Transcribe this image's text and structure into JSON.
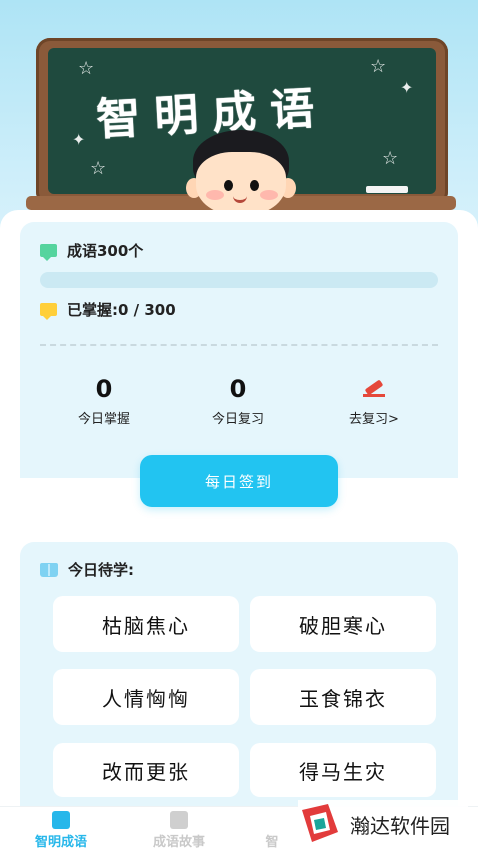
{
  "banner": {
    "title": "智明成语"
  },
  "stats": {
    "total_label": "成语300个",
    "mastered_label": "已掌握:0 / 300",
    "progress": 0,
    "today_mastered_value": "0",
    "today_mastered_label": "今日掌握",
    "today_review_value": "0",
    "today_review_label": "今日复习",
    "go_review_label": "去复习>",
    "checkin_label": "每日签到"
  },
  "today": {
    "title": "今日待学:",
    "idioms": [
      "枯脑焦心",
      "破胆寒心",
      "人情恟恟",
      "玉食锦衣",
      "改而更张",
      "得马生灾"
    ]
  },
  "tabbar": {
    "tabs": [
      {
        "label": "智明成语",
        "active": true
      },
      {
        "label": "成语故事",
        "active": false
      },
      {
        "label": "智",
        "active": false
      }
    ]
  },
  "watermark": {
    "text": "瀚达软件园"
  },
  "colors": {
    "accent": "#22c4f1",
    "card_bg": "#e5f6fc",
    "board": "#1f4a3e",
    "board_frame": "#8a5a3a"
  }
}
